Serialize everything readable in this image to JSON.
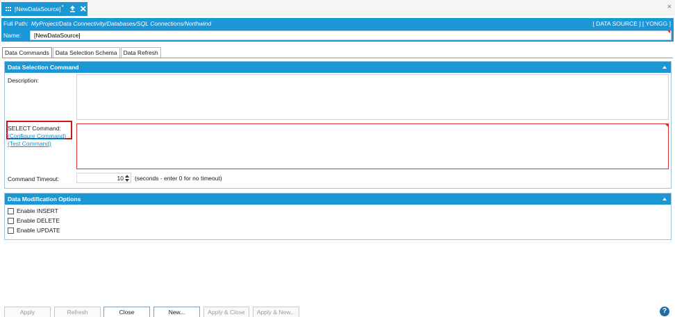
{
  "window": {
    "tab_title": "[NewDataSource]",
    "modified_marker": "*",
    "close_glyph": "✕",
    "window_close_glyph": "×"
  },
  "header": {
    "full_path_label": "Full Path:",
    "full_path_value": "MyProject/Data Connectivity/Databases/SQL Connections/Northwind",
    "right_info": "[ DATA SOURCE ] [ YONGG ]",
    "name_label": "Name:",
    "name_value": "[NewDataSource]"
  },
  "tabs": [
    {
      "label": "Data Commands",
      "active": true
    },
    {
      "label": "Data Selection Schema",
      "active": false
    },
    {
      "label": "Data Refresh",
      "active": false
    }
  ],
  "data_selection": {
    "title": "Data Selection Command",
    "description_label": "Description:",
    "description_value": "",
    "select_label": "SELECT Command:",
    "configure_link": "(Configure Command)",
    "test_link": "(Test Command)",
    "timeout_label": "Command Timeout:",
    "timeout_value": "10",
    "timeout_hint": "(seconds - enter 0 for no timeout)"
  },
  "data_modification": {
    "title": "Data Modification Options",
    "options": [
      {
        "label": "Enable INSERT",
        "checked": false
      },
      {
        "label": "Enable DELETE",
        "checked": false
      },
      {
        "label": "Enable UPDATE",
        "checked": false
      }
    ]
  },
  "buttons": {
    "apply": "Apply",
    "refresh": "Refresh",
    "close": "Close",
    "new": "New...",
    "apply_close": "Apply & Close",
    "apply_new": "Apply & New..."
  },
  "help_glyph": "?",
  "colors": {
    "accent": "#1c97d6",
    "error": "#d9302c",
    "highlight": "#d0141b",
    "link": "#1a8fd0"
  }
}
